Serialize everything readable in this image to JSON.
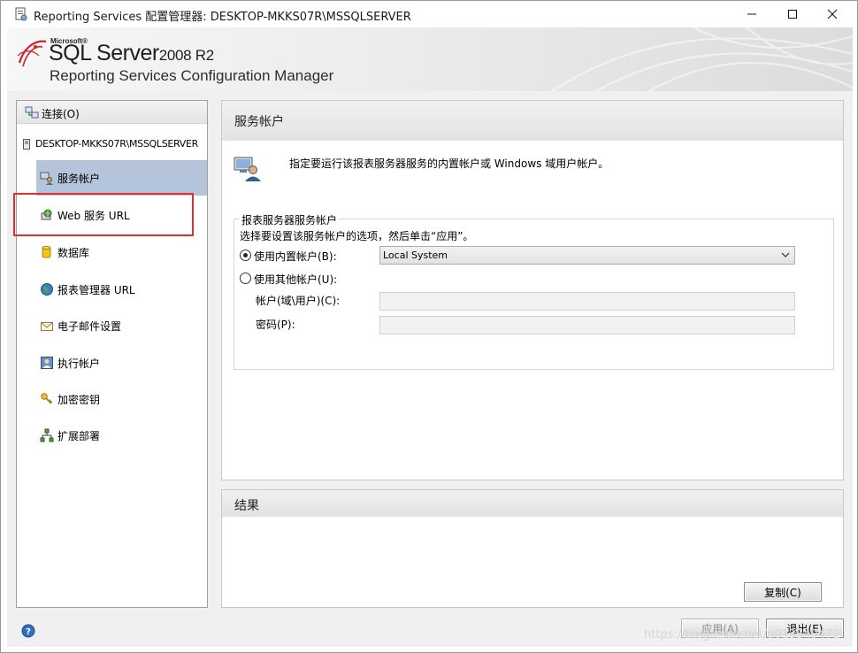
{
  "window": {
    "title": "Reporting Services 配置管理器: DESKTOP-MKKS07R\\MSSQLSERVER"
  },
  "banner": {
    "brand_small": "Microsoft®",
    "product": "SQL Server",
    "version": "2008 R2",
    "subtitle": "Reporting Services Configuration Manager"
  },
  "sidebar": {
    "connect_label": "连接(O)",
    "server_label": "DESKTOP-MKKS07R\\MSSQLSERVER",
    "items": [
      {
        "label": "服务帐户",
        "icon": "service-account-icon",
        "active": true
      },
      {
        "label": "Web 服务 URL",
        "icon": "web-service-icon",
        "active": false
      },
      {
        "label": "数据库",
        "icon": "database-icon",
        "active": false
      },
      {
        "label": "报表管理器 URL",
        "icon": "globe-icon",
        "active": false
      },
      {
        "label": "电子邮件设置",
        "icon": "email-icon",
        "active": false
      },
      {
        "label": "执行帐户",
        "icon": "execution-account-icon",
        "active": false
      },
      {
        "label": "加密密钥",
        "icon": "key-icon",
        "active": false
      },
      {
        "label": "扩展部署",
        "icon": "scale-out-icon",
        "active": false
      }
    ]
  },
  "main": {
    "header": "服务帐户",
    "description": "指定要运行该报表服务器服务的内置帐户或 Windows 域用户帐户。",
    "group": {
      "title": "报表服务器服务帐户",
      "instruction": "选择要设置该服务帐户的选项，然后单击“应用”。",
      "builtin_radio_label": "使用内置帐户(B):",
      "builtin_selected": true,
      "builtin_value": "Local System",
      "other_radio_label": "使用其他帐户(U):",
      "account_label": "帐户(域\\用户)(C):",
      "account_value": "",
      "password_label": "密码(P):",
      "password_value": ""
    }
  },
  "results": {
    "header": "结果",
    "copy_button": "复制(C)"
  },
  "footer": {
    "apply_button": "应用(A)",
    "exit_button": "退出(E)",
    "watermark": "https://blog.csdn.net/u013349472"
  },
  "colors": {
    "nav_active_bg": "#b3c4db",
    "highlight_border": "#e0302a"
  }
}
